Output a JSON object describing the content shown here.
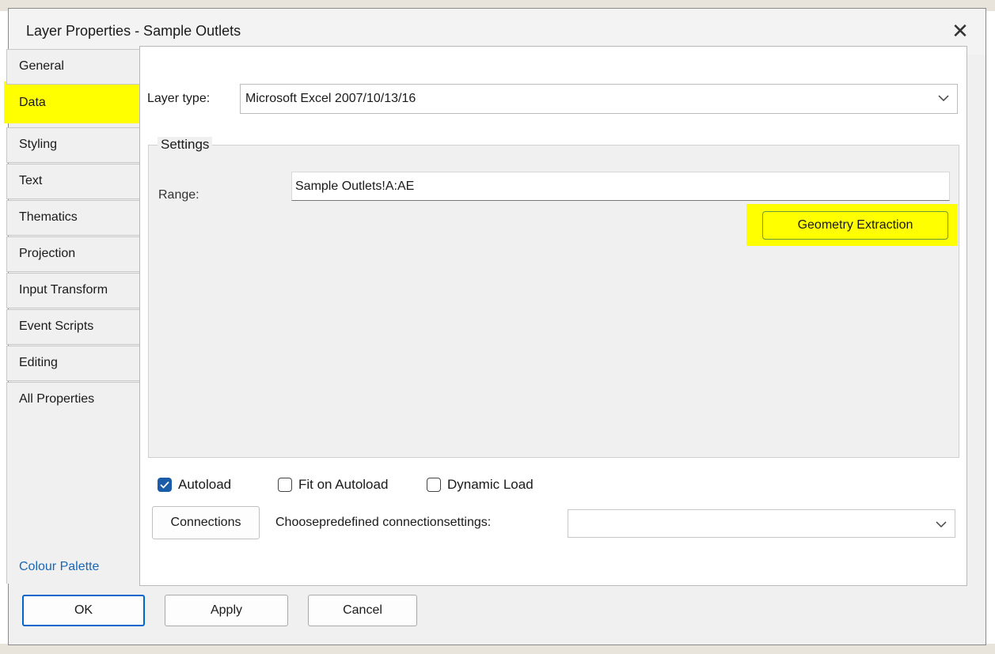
{
  "dialog": {
    "title": "Layer Properties - Sample Outlets",
    "close_glyph": "✕"
  },
  "tabs": [
    {
      "label": "General"
    },
    {
      "label": "Data"
    },
    {
      "label": "Styling"
    },
    {
      "label": "Text"
    },
    {
      "label": "Thematics"
    },
    {
      "label": "Projection"
    },
    {
      "label": "Input Transform"
    },
    {
      "label": "Event Scripts"
    },
    {
      "label": "Editing"
    },
    {
      "label": "All Properties"
    }
  ],
  "active_tab": "Data",
  "colour_palette_link": "Colour Palette",
  "layer_type": {
    "label": "Layer type:",
    "value": "Microsoft Excel 2007/10/13/16"
  },
  "settings": {
    "legend": "Settings",
    "range_label": "Range:",
    "range_value": "Sample Outlets!A:AE",
    "geometry_button": "Geometry Extraction"
  },
  "checkboxes": [
    {
      "label": "Autoload",
      "checked": true
    },
    {
      "label": "Fit on Autoload",
      "checked": false
    },
    {
      "label": "Dynamic Load",
      "checked": false
    }
  ],
  "connections_button": "Connections",
  "choose_label": "Choosepredefined connectionsettings:",
  "choose_value": "",
  "buttons": {
    "ok": "OK",
    "apply": "Apply",
    "cancel": "Cancel"
  },
  "colors": {
    "highlight": "#ffff00",
    "accent": "#1a5ca8",
    "link": "#1a66b3"
  },
  "icons": {
    "close": "close-icon",
    "dropdown": "chevron-down-icon",
    "check": "checkmark-icon"
  }
}
